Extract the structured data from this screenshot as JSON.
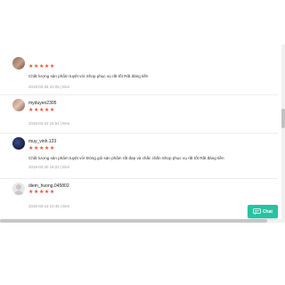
{
  "reviews": [
    {
      "author": "",
      "stars": "★★★★★",
      "comment": "Chất lượng sản phẩm tuyệt vời Shop phục vụ rất tốt Rất đáng tiền",
      "meta": "2018-03-26 22:05 | Đen"
    },
    {
      "author": "myduyen2305",
      "stars": "★★★★★",
      "comment": "",
      "meta": "2018-03-22 16:54 | Đen"
    },
    {
      "author": "muy_vinh.123",
      "stars": "★★★★★",
      "comment": "Chất lượng sản phẩm tuyệt vời Đóng gói sản phẩm rất đẹp và chắc chắn Shop phục vụ rất tốt Rất đáng tiền",
      "meta": "2018-03-20 18:22 | Đen"
    },
    {
      "author": "diem_huong.045802",
      "stars": "★★★★★",
      "comment": "",
      "meta": "2018-03-13 10:45 | Đen"
    }
  ],
  "chat": {
    "label": "Chat"
  },
  "colors": {
    "star": "#ee4d2d",
    "chat_bg": "#26c3a0"
  }
}
